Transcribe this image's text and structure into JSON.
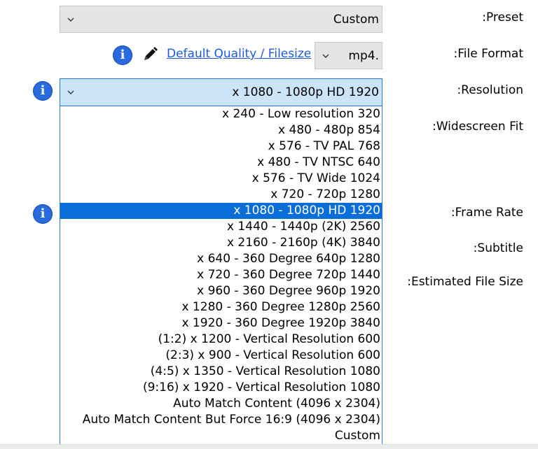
{
  "labels": {
    "preset": ":Preset",
    "file_format": ":File Format",
    "resolution": ":Resolution",
    "widescreen_fit": ":Widescreen Fit",
    "frame_rate": ":Frame Rate",
    "subtitle": ":Subtitle",
    "estimated_file_size": ":Estimated File Size"
  },
  "preset": {
    "value": "Custom"
  },
  "file_format": {
    "value": "mp4.",
    "quality_link": "Default Quality / Filesize"
  },
  "resolution": {
    "value": "x 1080 - 1080p HD 1920",
    "options": [
      "x 240 - Low resolution 320",
      "x 480 - 480p 854",
      "x 576 - TV PAL 768",
      "x 480 - TV NTSC 640",
      "x 576 - TV Wide 1024",
      "x 720 - 720p 1280",
      "x 1080 - 1080p HD 1920",
      "x 1440 - 1440p (2K) 2560",
      "x 2160 - 2160p (4K) 3840",
      "x 640 - 360 Degree 640p 1280",
      "x 720 - 360 Degree 720p 1440",
      "x 960 - 360 Degree 960p 1920",
      "x 1280 - 360 Degree 1280p 2560",
      "x 1920 - 360 Degree 1920p 3840",
      "(1:2) x 1200 - Vertical Resolution 600",
      "(2:3) x 900 - Vertical Resolution 600",
      "(4:5) x 1350 - Vertical Resolution 1080",
      "(9:16) x 1920 - Vertical Resolution 1080",
      "Auto Match Content (4096 x 2304)",
      "Auto Match Content But Force 16:9 (4096 x 2304)",
      "Custom"
    ],
    "selected_index": 6
  },
  "icons": {
    "info": "info-icon",
    "pencil": "pencil-icon",
    "chevron": "chevron-down-icon"
  },
  "colors": {
    "selection": "#0a6dd8",
    "info": "#2a6ae0",
    "link": "#1f5bd6",
    "dropdown_border": "#2b7bd1"
  }
}
